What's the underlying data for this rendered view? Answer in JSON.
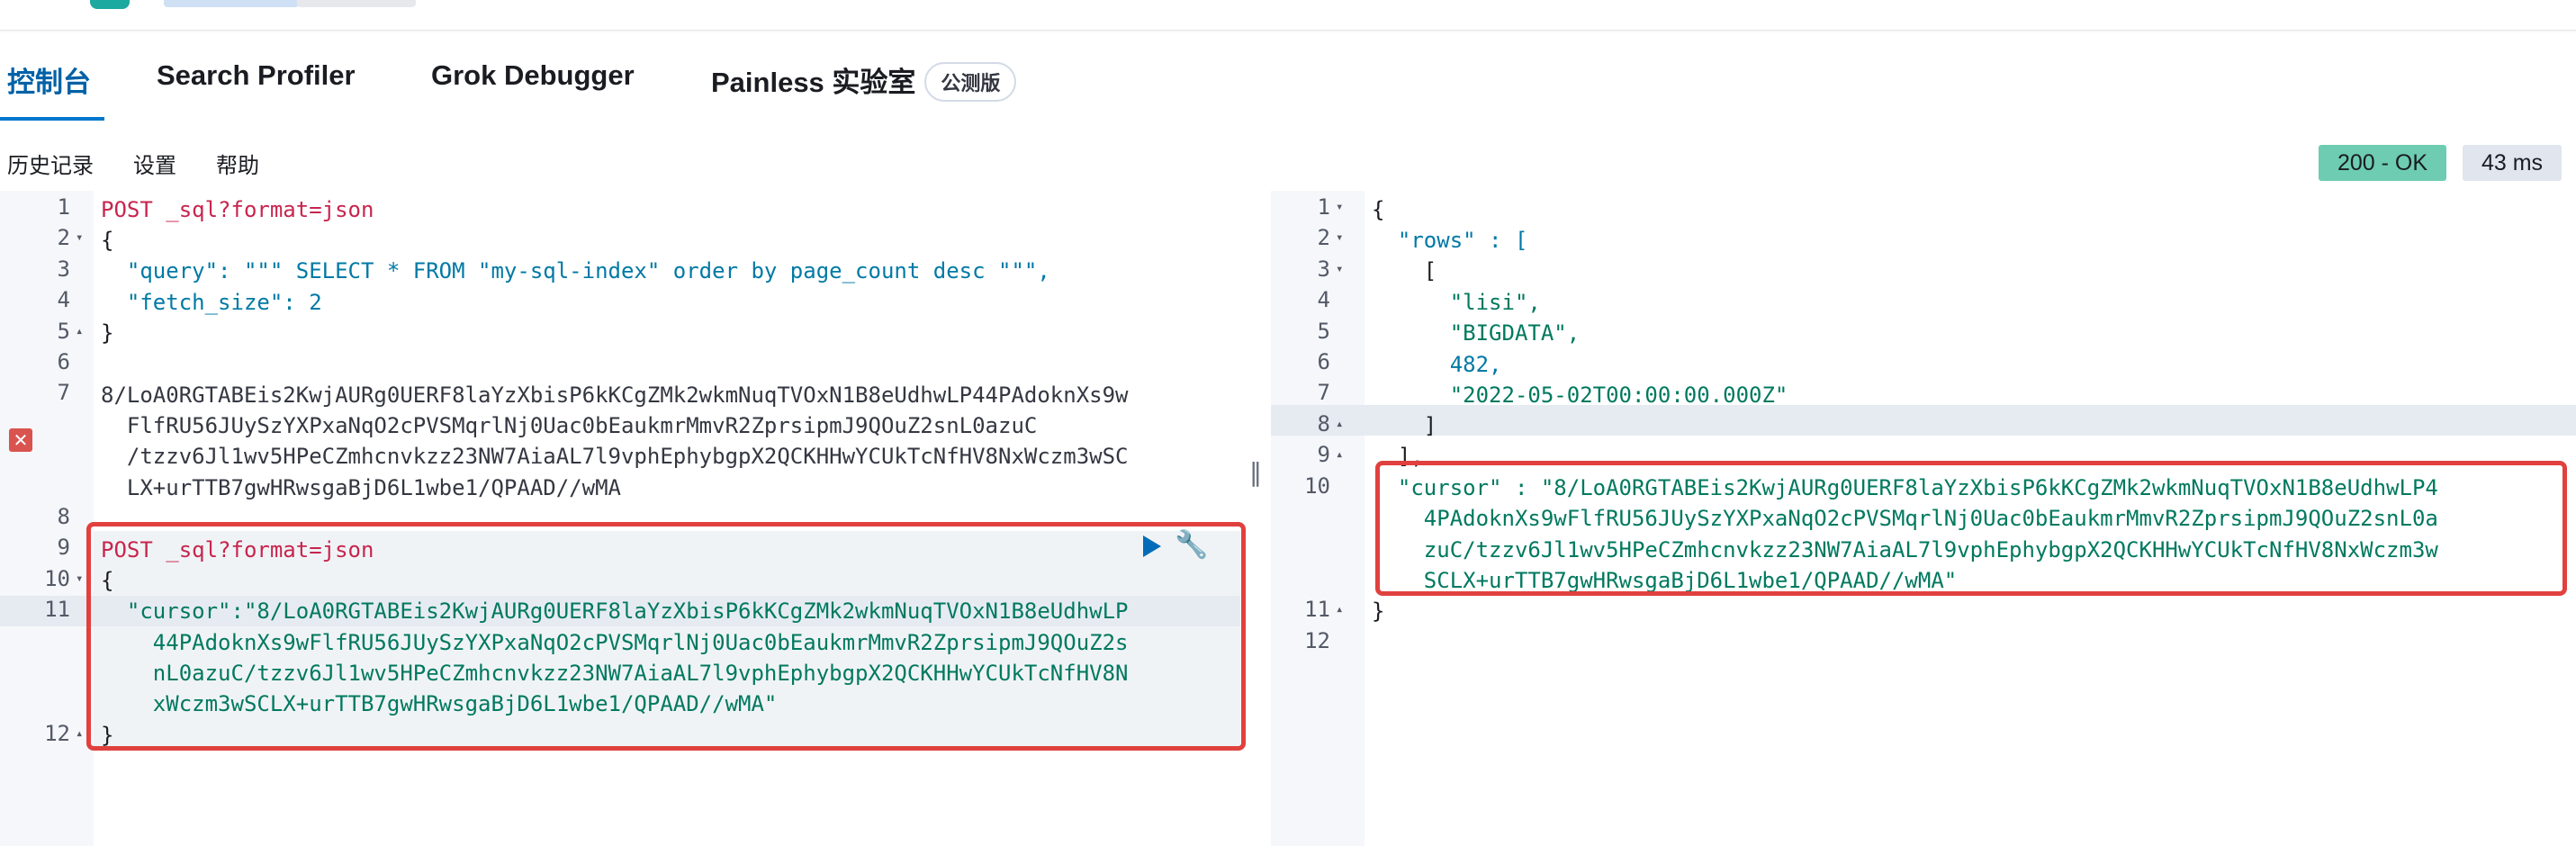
{
  "tabs": [
    {
      "label": "控制台",
      "active": true
    },
    {
      "label": "Search Profiler"
    },
    {
      "label": "Grok Debugger"
    },
    {
      "label": "Painless 实验室",
      "badge": "公测版"
    }
  ],
  "submenu": [
    "历史记录",
    "设置",
    "帮助"
  ],
  "status": {
    "code": "200 - OK",
    "time": "43 ms"
  },
  "request": {
    "lines": [
      {
        "n": "1",
        "text": "POST _sql?format=json"
      },
      {
        "n": "2",
        "text": "{"
      },
      {
        "n": "3",
        "text": "  \"query\": \"\"\" SELECT * FROM \"my-sql-index\" order by page_count desc \"\"\","
      },
      {
        "n": "4",
        "text": "  \"fetch_size\": 2"
      },
      {
        "n": "5",
        "text": "}"
      },
      {
        "n": "6",
        "text": ""
      },
      {
        "n": "7",
        "text": "8/LoA0RGTABEis2KwjAURg0UERF8laYzXbisP6kKCgZMk2wkmNuqTVOxN1B8eUdhwLP44PAdoknXs9w"
      },
      {
        "n": "",
        "text": "  FlfRU56JUySzYXPxaNqO2cPVSMqrlNj0Uac0bEaukmrMmvR2ZprsipmJ9QOuZ2snL0azuC"
      },
      {
        "n": "",
        "text": "  /tzzv6Jl1wv5HPeCZmhcnvkzz23NW7AiaAL7l9vphEphybgpX2QCKHHwYCUkTcNfHV8NxWczm3wSC"
      },
      {
        "n": "",
        "text": "  LX+urTTB7gwHRwsgaBjD6L1wbe1/QPAAD//wMA"
      },
      {
        "n": "8",
        "text": ""
      },
      {
        "n": "9",
        "text": "POST _sql?format=json"
      },
      {
        "n": "10",
        "text": "{"
      },
      {
        "n": "11",
        "text": "  \"cursor\":\"8/LoA0RGTABEis2KwjAURg0UERF8laYzXbisP6kKCgZMk2wkmNuqTVOxN1B8eUdhwLP"
      },
      {
        "n": "",
        "text": "    44PAdoknXs9wFlfRU56JUySzYXPxaNqO2cPVSMqrlNj0Uac0bEaukmrMmvR2ZprsipmJ9QOuZ2s"
      },
      {
        "n": "",
        "text": "    nL0azuC/tzzv6Jl1wv5HPeCZmhcnvkzz23NW7AiaAL7l9vphEphybgpX2QCKHHwYCUkTcNfHV8N"
      },
      {
        "n": "",
        "text": "    xWczm3wSCLX+urTTB7gwHRwsgaBjD6L1wbe1/QPAAD//wMA\""
      },
      {
        "n": "12",
        "text": "}"
      }
    ]
  },
  "response": {
    "lines": [
      {
        "n": "1",
        "text": "{"
      },
      {
        "n": "2",
        "text": "  \"rows\" : ["
      },
      {
        "n": "3",
        "text": "    ["
      },
      {
        "n": "4",
        "text": "      \"lisi\","
      },
      {
        "n": "5",
        "text": "      \"BIGDATA\","
      },
      {
        "n": "6",
        "text": "      482,"
      },
      {
        "n": "7",
        "text": "      \"2022-05-02T00:00:00.000Z\""
      },
      {
        "n": "8",
        "text": "    ]"
      },
      {
        "n": "9",
        "text": "  ],"
      },
      {
        "n": "10",
        "text": "  \"cursor\" : \"8/LoA0RGTABEis2KwjAURg0UERF8laYzXbisP6kKCgZMk2wkmNuqTVOxN1B8eUdhwLP4"
      },
      {
        "n": "",
        "text": "    4PAdoknXs9wFlfRU56JUySzYXPxaNqO2cPVSMqrlNj0Uac0bEaukmrMmvR2ZprsipmJ9QOuZ2snL0a"
      },
      {
        "n": "",
        "text": "    zuC/tzzv6Jl1wv5HPeCZmhcnvkzz23NW7AiaAL7l9vphEphybgpX2QCKHHwYCUkTcNfHV8NxWczm3w"
      },
      {
        "n": "",
        "text": "    SCLX+urTTB7gwHRwsgaBjD6L1wbe1/QPAAD//wMA\""
      },
      {
        "n": "11",
        "text": "}"
      },
      {
        "n": "12",
        "text": ""
      }
    ]
  },
  "colors": {
    "accent": "#0077cc",
    "ok": "#6dccb1",
    "highlight_box": "#e0413e"
  }
}
